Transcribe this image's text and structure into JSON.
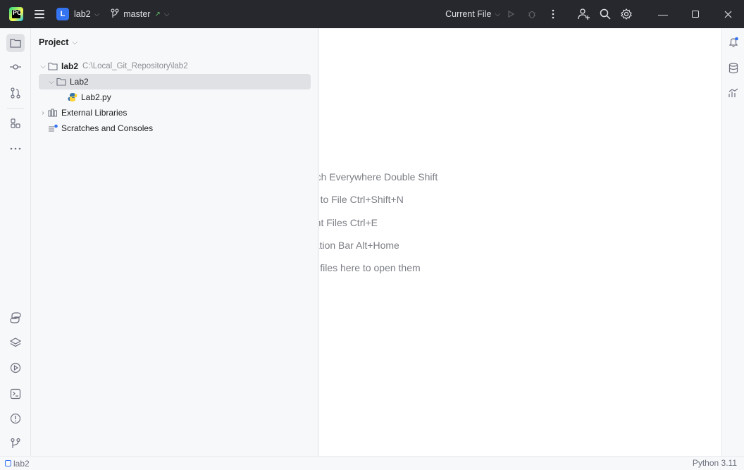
{
  "titlebar": {
    "app_logo": "PC",
    "project_badge": "L",
    "project_name": "lab2",
    "branch": "master",
    "run_config": "Current File"
  },
  "project_panel": {
    "title": "Project",
    "tree": [
      {
        "label": "lab2",
        "path": "C:\\Local_Git_Repository\\lab2",
        "bold": true
      },
      {
        "label": "Lab2"
      },
      {
        "label": "Lab2.py"
      },
      {
        "label": "External Libraries"
      },
      {
        "label": "Scratches and Consoles"
      }
    ]
  },
  "editor": {
    "hints": [
      "Search Everywhere Double Shift",
      "Go to File Ctrl+Shift+N",
      "Recent Files Ctrl+E",
      "Navigation Bar Alt+Home",
      "Drop files here to open them"
    ]
  },
  "statusbar": {
    "breadcrumb": "lab2",
    "interpreter": "Python 3.11"
  },
  "colors": {
    "titlebar_bg": "#27282e",
    "accent_blue": "#3574f0",
    "selection": "#dfe1e5"
  }
}
